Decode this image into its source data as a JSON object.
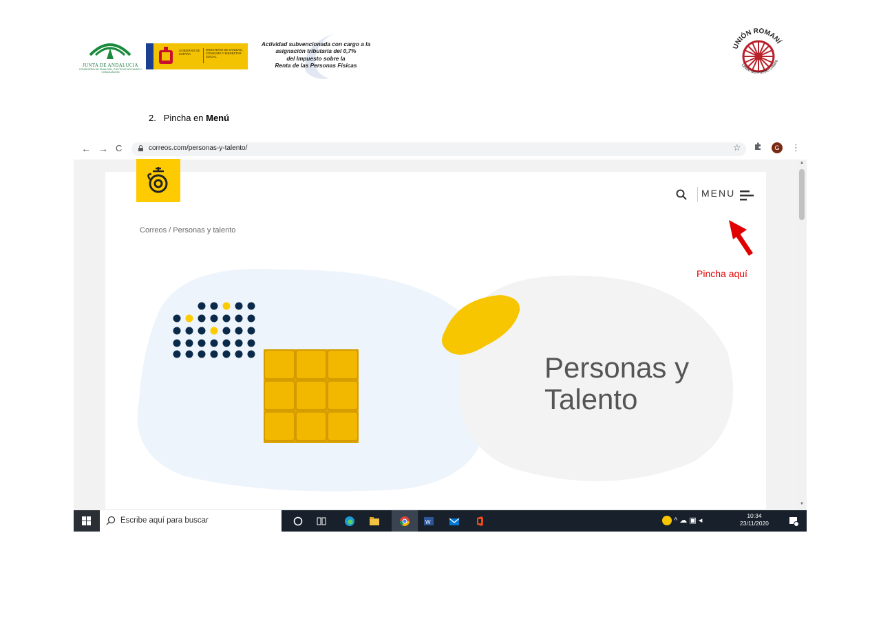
{
  "header": {
    "logo_left_name": "JUNTA DE ANDALUCIA",
    "logo_left_sub": "CONSEJERÍA DE IGUALDAD, POLÍTICAS SOCIALES Y CONCILIACIÓN",
    "gov_label_1": "GOBIERNO DE ESPAÑA",
    "gov_label_2": "MINISTERIO DE SANIDAD, CONSUMO Y BIENESTAR SOCIAL",
    "subsidy_lines": [
      "Actividad subvencionada con cargo a la",
      "asignación tributaria del 0,7%",
      "del Impuesto sobre la",
      "Renta de las Personas Físicas"
    ],
    "right_logo_top": "UNIÓN ROMANÍ",
    "right_logo_bottom": "Unión del Pueblo Gitano"
  },
  "step": {
    "number": "2.",
    "text": "Pincha en ",
    "bold": "Menú"
  },
  "browser": {
    "url": "correos.com/personas-y-talento/",
    "profile_initial": "G",
    "nav_back": "←",
    "nav_forward": "→",
    "nav_reload": "C",
    "star": "☆",
    "kebab": "⋮"
  },
  "site": {
    "menu_label": "MENU",
    "breadcrumb": "Correos / Personas y talento",
    "hero_line1": "Personas y",
    "hero_line2": "Talento"
  },
  "annotation": {
    "text": "Pincha aquí",
    "color": "#e00000"
  },
  "taskbar": {
    "search_placeholder": "Escribe aquí para buscar",
    "time": "10:34",
    "date": "23/11/2020"
  },
  "colors": {
    "correos_yellow": "#fdcb00",
    "dots_navy": "#0b2a4a",
    "annotation_red": "#e00000"
  }
}
